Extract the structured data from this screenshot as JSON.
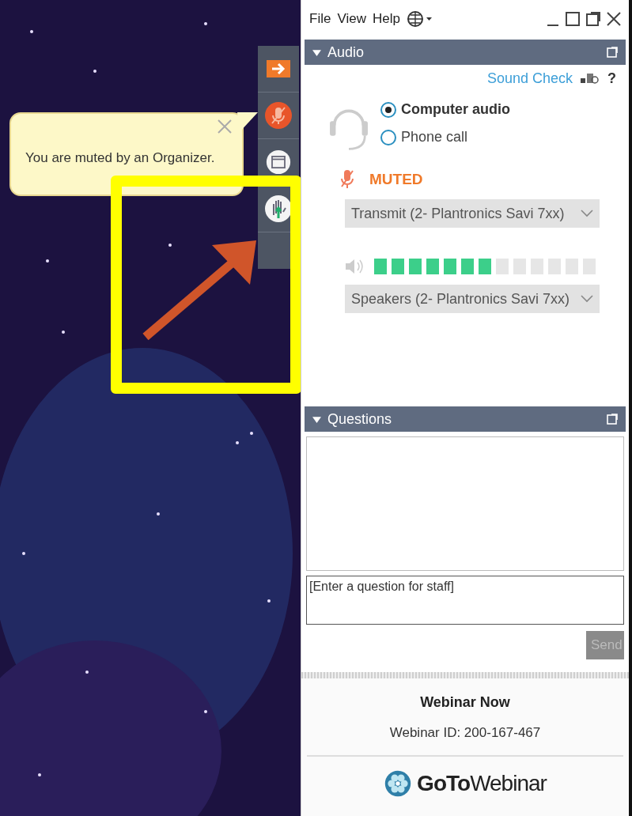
{
  "notification": {
    "message": "You are muted by an Organizer."
  },
  "menu": [
    "File",
    "View",
    "Help"
  ],
  "audio": {
    "title": "Audio",
    "expanded": true,
    "sound_check": "Sound Check",
    "help": "?",
    "modes": [
      {
        "label": "Computer audio",
        "selected": true
      },
      {
        "label": "Phone call",
        "selected": false
      }
    ],
    "status": "MUTED",
    "microphone": "Transmit (2- Plantronics Savi 7xx)",
    "speaker_meter": {
      "level": 0.54
    },
    "speakers": "Speakers (2- Plantronics Savi 7xx)"
  },
  "questions": {
    "title": "Questions",
    "expanded": true,
    "placeholder": "[Enter a question for staff]",
    "send": "Send",
    "send_disabled": true
  },
  "footer": {
    "webinar_name": "Webinar Now",
    "webinar_id": "Webinar ID: 200-167-467",
    "logo": "**GoTo**Webinar"
  }
}
